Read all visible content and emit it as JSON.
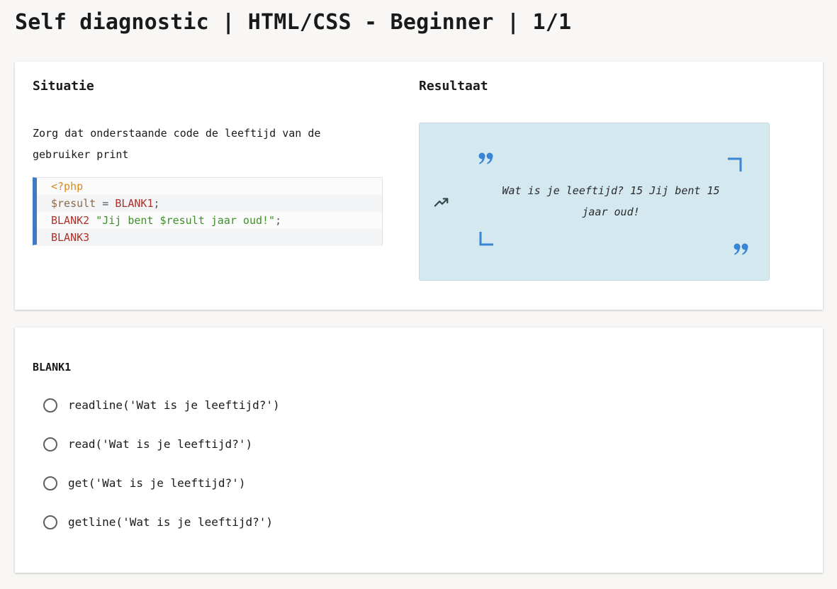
{
  "page": {
    "title": "Self diagnostic | HTML/CSS - Beginner | 1/1"
  },
  "situation": {
    "heading": "Situatie",
    "instruction": "Zorg dat onderstaande code de leeftijd van de gebruiker print",
    "code": {
      "line1": {
        "tag": "<?php"
      },
      "line2": {
        "var": "$result",
        "op": " = ",
        "blank": "BLANK1",
        "end": ";"
      },
      "line3": {
        "blank": "BLANK2",
        "space": " ",
        "string": "\"Jij bent $result jaar oud!\"",
        "end": ";"
      },
      "line4": {
        "blank": "BLANK3"
      }
    }
  },
  "result": {
    "heading": "Resultaat",
    "text": "Wat is je leeftijd? 15 Jij bent 15 jaar oud!"
  },
  "question": {
    "label": "BLANK1",
    "options": [
      "readline('Wat is je leeftijd?')",
      "read('Wat is je leeftijd?')",
      "get('Wat is je leeftijd?')",
      "getline('Wat is je leeftijd?')"
    ]
  },
  "colors": {
    "accent_blue": "#3d7ac6",
    "result_background": "#d3e8ef",
    "quote_blue": "#3a86d6"
  }
}
